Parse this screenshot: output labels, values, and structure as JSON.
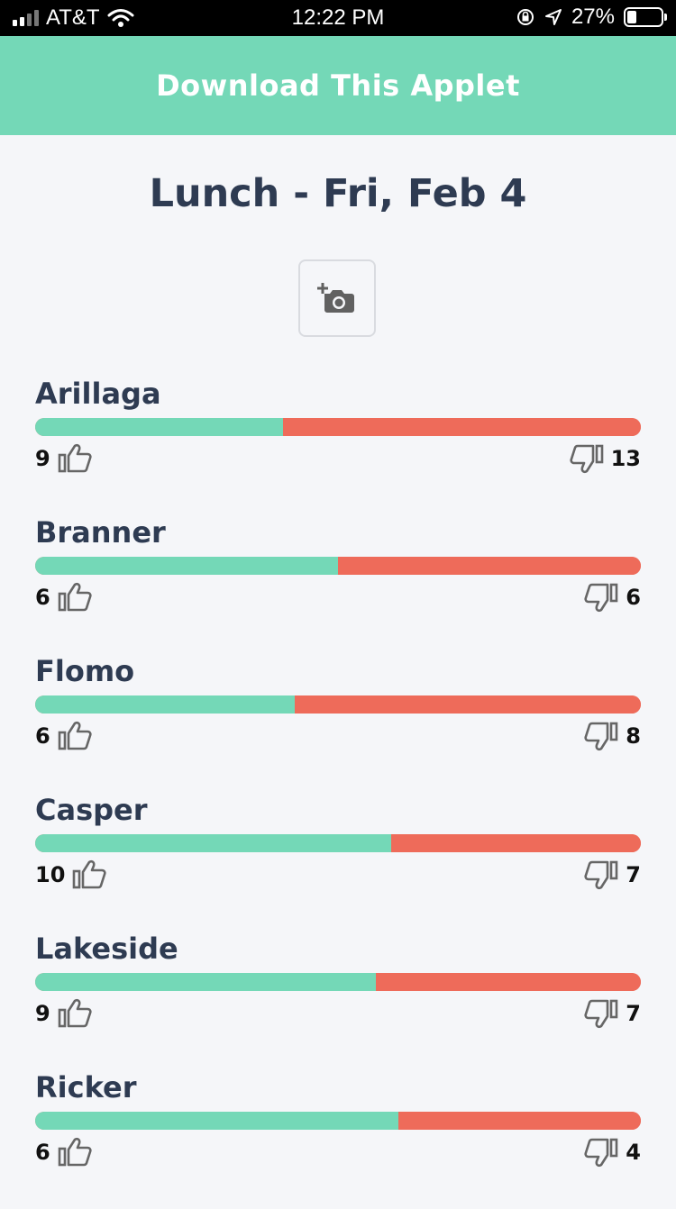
{
  "status_bar": {
    "carrier": "AT&T",
    "time": "12:22 PM",
    "battery": "27%",
    "battery_level": 0.27
  },
  "banner": {
    "label": "Download This Applet"
  },
  "page": {
    "title": "Lunch - Fri, Feb 4"
  },
  "icons": {
    "photo": "add-photo-icon",
    "up": "thumbs-up-icon",
    "down": "thumbs-down-icon"
  },
  "colors": {
    "accent": "#74d8b7",
    "negative": "#ee6b5a",
    "title": "#2e3b52"
  },
  "dining_halls": [
    {
      "name": "Arillaga",
      "up": 9,
      "down": 13
    },
    {
      "name": "Branner",
      "up": 6,
      "down": 6
    },
    {
      "name": "Flomo",
      "up": 6,
      "down": 8
    },
    {
      "name": "Casper",
      "up": 10,
      "down": 7
    },
    {
      "name": "Lakeside",
      "up": 9,
      "down": 7
    },
    {
      "name": "Ricker",
      "up": 6,
      "down": 4
    }
  ]
}
